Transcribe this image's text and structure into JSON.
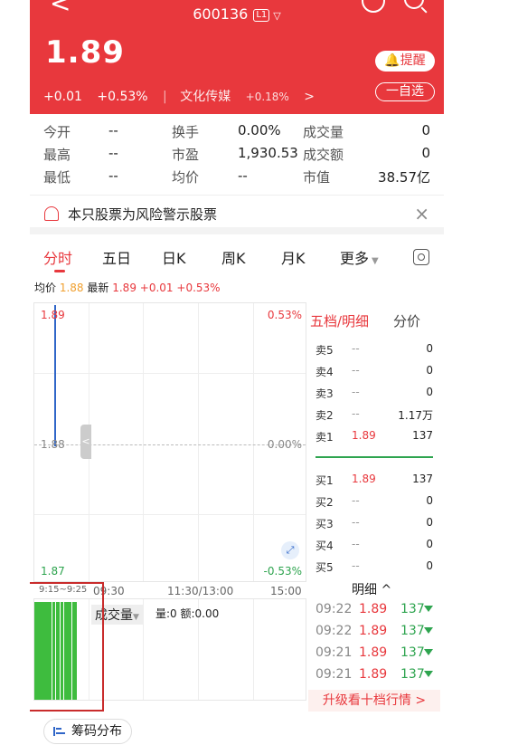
{
  "header": {
    "back": "<",
    "code": "600136",
    "level": "L1",
    "chevron": "▽",
    "price": "1.89",
    "change": "+0.01",
    "change_pct": "+0.53%",
    "sector": "文化传媒",
    "sector_pct": "+0.18%",
    "sector_arrow": ">",
    "alert_label": "提醒",
    "alert_icon": "bell-icon",
    "fav_label": "一自选"
  },
  "stats": [
    {
      "label": "今开",
      "value": "--"
    },
    {
      "label": "换手",
      "value": "0.00%"
    },
    {
      "label": "成交量",
      "value": "0"
    },
    {
      "label": "最高",
      "value": "--"
    },
    {
      "label": "市盈",
      "value": "1,930.53"
    },
    {
      "label": "成交额",
      "value": "0"
    },
    {
      "label": "最低",
      "value": "--"
    },
    {
      "label": "均价",
      "value": "--"
    },
    {
      "label": "市值",
      "value": "38.57亿"
    }
  ],
  "risk": {
    "text": "本只股票为风险警示股票",
    "close": "×"
  },
  "tabs": [
    "分时",
    "五日",
    "日K",
    "周K",
    "月K",
    "更多"
  ],
  "avg_line": {
    "avg_label": "均价",
    "avg_value": "1.88",
    "latest_label": "最新",
    "latest_value": "1.89",
    "change": "+0.01",
    "pct": "+0.53%"
  },
  "chart": {
    "y_top": "1.89",
    "y_mid": "1.88",
    "y_bottom": "1.87",
    "pct_top": "0.53%",
    "pct_mid": "0.00%",
    "pct_bottom": "-0.53%",
    "handle": "<",
    "expand_icon": "expand-icon",
    "times": [
      "9:15~9:25",
      "09:30",
      "11:30/13:00",
      "15:00"
    ]
  },
  "volume": {
    "label": "成交量",
    "info": "量:0 额:0.00"
  },
  "book": {
    "title": "五档/明细",
    "title2": "分价",
    "sells": [
      {
        "name": "卖5",
        "price": "--",
        "vol": "0"
      },
      {
        "name": "卖4",
        "price": "--",
        "vol": "0"
      },
      {
        "name": "卖3",
        "price": "--",
        "vol": "0"
      },
      {
        "name": "卖2",
        "price": "--",
        "vol": "1.17万"
      },
      {
        "name": "卖1",
        "price": "1.89",
        "vol": "137"
      }
    ],
    "buys": [
      {
        "name": "买1",
        "price": "1.89",
        "vol": "137"
      },
      {
        "name": "买2",
        "price": "--",
        "vol": "0"
      },
      {
        "name": "买3",
        "price": "--",
        "vol": "0"
      },
      {
        "name": "买4",
        "price": "--",
        "vol": "0"
      },
      {
        "name": "买5",
        "price": "--",
        "vol": "0"
      }
    ],
    "detail_title": "明细 ^",
    "trades": [
      {
        "time": "09:22",
        "price": "1.89",
        "vol": "137"
      },
      {
        "time": "09:22",
        "price": "1.89",
        "vol": "137"
      },
      {
        "time": "09:21",
        "price": "1.89",
        "vol": "137"
      },
      {
        "time": "09:21",
        "price": "1.89",
        "vol": "137"
      }
    ],
    "upgrade": "升级看十档行情 >"
  },
  "chips": {
    "label": "筹码分布"
  }
}
